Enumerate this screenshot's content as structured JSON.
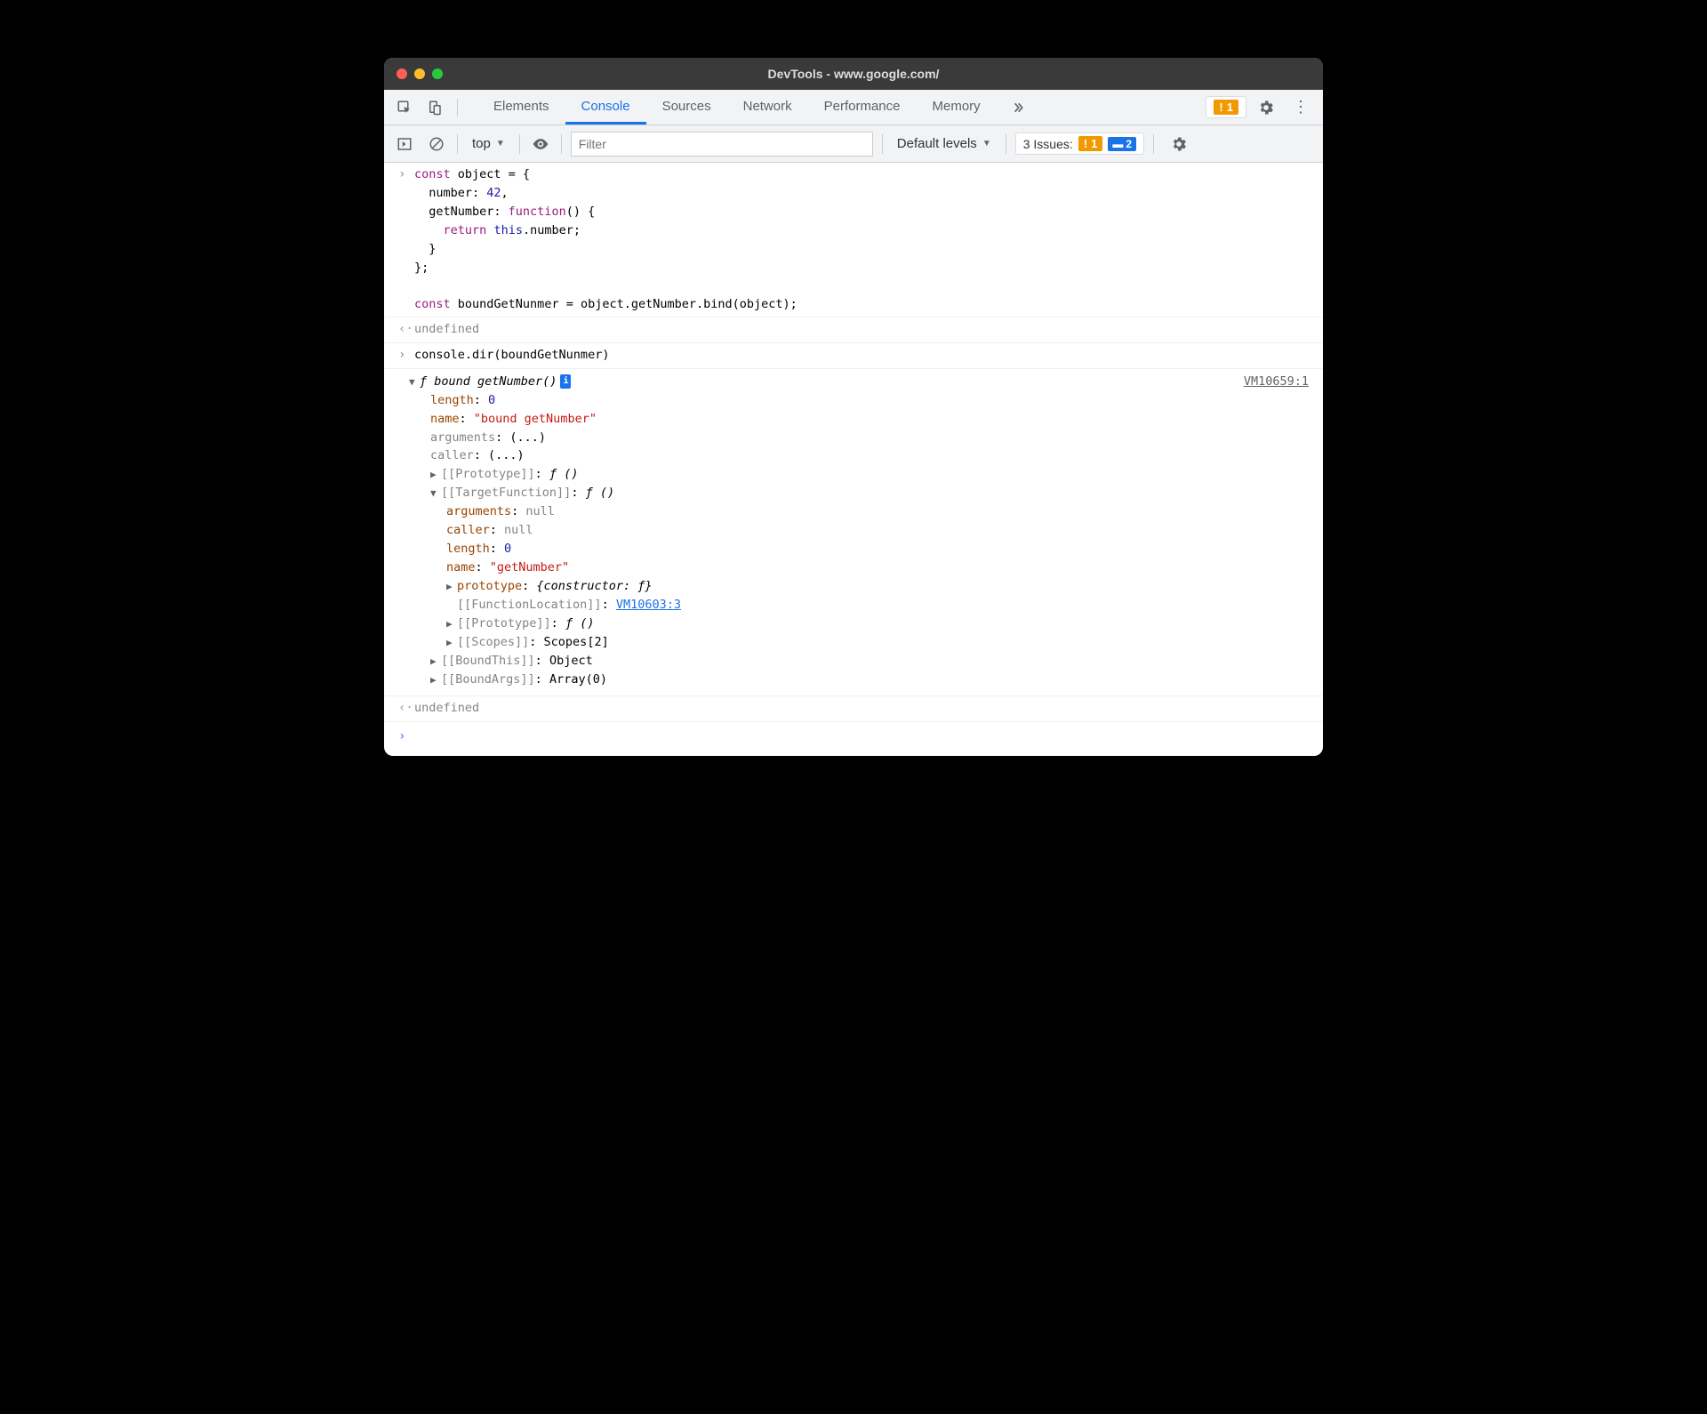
{
  "window": {
    "title": "DevTools - www.google.com/"
  },
  "tabs": {
    "items": [
      "Elements",
      "Console",
      "Sources",
      "Network",
      "Performance",
      "Memory"
    ],
    "active_index": 1
  },
  "topbar": {
    "warning_count": "1"
  },
  "toolbar": {
    "context": "top",
    "filter_placeholder": "Filter",
    "levels": "Default levels",
    "issues_label": "3 Issues:",
    "issues_warn": "1",
    "issues_info": "2"
  },
  "code": {
    "input1_lines": [
      {
        "segments": [
          {
            "t": "const ",
            "c": "kw"
          },
          {
            "t": "object = {",
            "c": ""
          }
        ]
      },
      {
        "segments": [
          {
            "t": "  number: ",
            "c": ""
          },
          {
            "t": "42",
            "c": "num"
          },
          {
            "t": ",",
            "c": ""
          }
        ]
      },
      {
        "segments": [
          {
            "t": "  getNumber: ",
            "c": ""
          },
          {
            "t": "function",
            "c": "fn"
          },
          {
            "t": "() {",
            "c": ""
          }
        ]
      },
      {
        "segments": [
          {
            "t": "    ",
            "c": ""
          },
          {
            "t": "return",
            "c": "kw"
          },
          {
            "t": " ",
            "c": ""
          },
          {
            "t": "this",
            "c": "num"
          },
          {
            "t": ".number;",
            "c": ""
          }
        ]
      },
      {
        "segments": [
          {
            "t": "  }",
            "c": ""
          }
        ]
      },
      {
        "segments": [
          {
            "t": "};",
            "c": ""
          }
        ]
      },
      {
        "segments": [
          {
            "t": "",
            "c": ""
          }
        ]
      },
      {
        "segments": [
          {
            "t": "const ",
            "c": "kw"
          },
          {
            "t": "boundGetNunmer = object.getNumber.bind(object);",
            "c": ""
          }
        ]
      }
    ],
    "result1": "undefined",
    "input2": "console.dir(boundGetNunmer)",
    "tree": {
      "header": "ƒ bound getNumber()",
      "vm": "VM10659:1",
      "length_label": "length",
      "length_val": "0",
      "name_label": "name",
      "name_val": "\"bound getNumber\"",
      "arguments_label": "arguments",
      "ellipsis": "(...)",
      "caller_label": "caller",
      "proto_label": "[[Prototype]]",
      "f_paren": "ƒ ()",
      "target_label": "[[TargetFunction]]",
      "t_arguments": "arguments",
      "null": "null",
      "t_caller": "caller",
      "t_length": "length",
      "t_length_val": "0",
      "t_name": "name",
      "t_name_val": "\"getNumber\"",
      "t_prototype": "prototype",
      "t_proto_val": "{constructor: ƒ}",
      "funcloc_label": "[[FunctionLocation]]",
      "funcloc_val": "VM10603:3",
      "t_proto2": "[[Prototype]]",
      "scopes_label": "[[Scopes]]",
      "scopes_val": "Scopes[2]",
      "boundthis_label": "[[BoundThis]]",
      "boundthis_val": "Object",
      "boundargs_label": "[[BoundArgs]]",
      "boundargs_val": "Array(0)"
    },
    "result2": "undefined"
  }
}
